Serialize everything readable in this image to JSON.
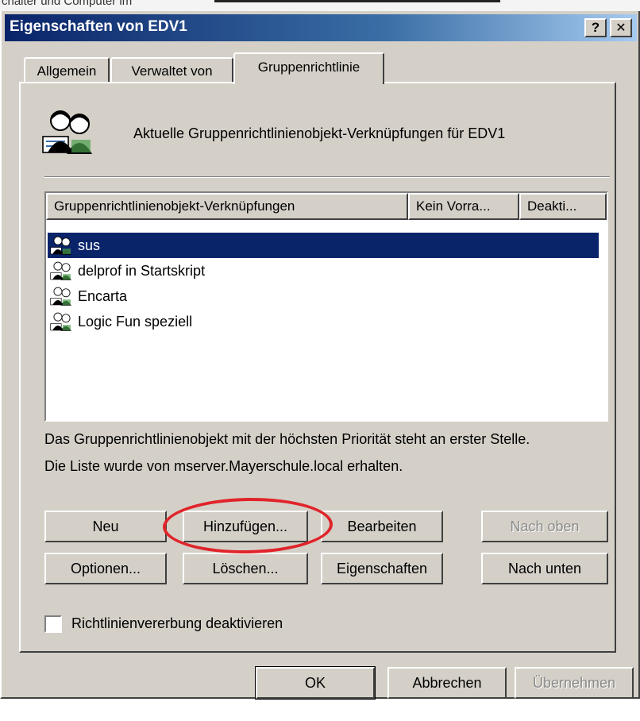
{
  "window": {
    "title": "Eigenschaften von EDV1",
    "help_label": "?",
    "close_label": "✕",
    "behind_text": "chalter und  Computer im"
  },
  "tabs": [
    {
      "label": "Allgemein",
      "active": false
    },
    {
      "label": "Verwaltet von",
      "active": false
    },
    {
      "label": "Gruppenrichtlinie",
      "active": true
    }
  ],
  "panel": {
    "header_text": "Aktuelle Gruppenrichtlinienobjekt-Verknüpfungen für EDV1",
    "list": {
      "columns": [
        "Gruppenrichtlinienobjekt-Verknüpfungen",
        "Kein Vorra...",
        "Deakti..."
      ],
      "rows": [
        {
          "label": "sus",
          "selected": true
        },
        {
          "label": "delprof in Startskript",
          "selected": false
        },
        {
          "label": "Encarta",
          "selected": false
        },
        {
          "label": "Logic Fun speziell",
          "selected": false
        }
      ]
    },
    "info_line1": "Das Gruppenrichtlinienobjekt mit der höchsten Priorität steht an erster Stelle.",
    "info_line2": "Die Liste wurde von mserver.Mayerschule.local erhalten.",
    "buttons": {
      "new": "Neu",
      "add": "Hinzufügen...",
      "edit": "Bearbeiten",
      "up": "Nach oben",
      "options": "Optionen...",
      "delete": "Löschen...",
      "properties": "Eigenschaften",
      "down": "Nach unten"
    },
    "block_inheritance_label": "Richtlinienvererbung deaktivieren",
    "block_inheritance_checked": false
  },
  "footer": {
    "ok": "OK",
    "cancel": "Abbrechen",
    "apply": "Übernehmen"
  },
  "colors": {
    "titlebar_start": "#0a246a",
    "selection": "#0a246a",
    "annotation": "#e0242a",
    "face": "#d4d0c8"
  },
  "icons": [
    "group-policy-icon",
    "gpo-link-icon",
    "help-icon",
    "close-icon"
  ]
}
